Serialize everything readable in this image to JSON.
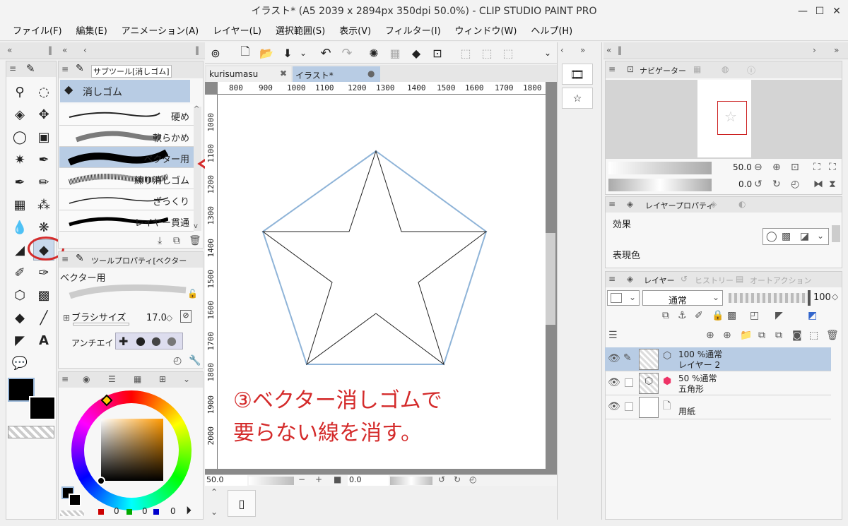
{
  "window": {
    "title": "イラスト* (A5 2039 x 2894px 350dpi 50.0%)  - CLIP STUDIO PAINT PRO",
    "controls": [
      "—",
      "☐",
      "✕"
    ]
  },
  "menu": [
    "ファイル(F)",
    "編集(E)",
    "アニメーション(A)",
    "レイヤー(L)",
    "選択範囲(S)",
    "表示(V)",
    "フィルター(I)",
    "ウィンドウ(W)",
    "ヘルプ(H)"
  ],
  "subtool": {
    "tab_label": "サブツール[消しゴム]",
    "group_name": "消しゴム",
    "brushes": [
      "硬め",
      "軟らかめ",
      "ベクター用",
      "練り消しゴム",
      "ざっくり",
      "レイヤー貫通"
    ],
    "selected": "ベクター用"
  },
  "tool_property": {
    "tab_label": "ツールプロパティ[ベクター",
    "preset_name": "ベクター用",
    "brush_size_label": "ブラシサイズ",
    "brush_size_value": "17.0",
    "antialias_label": "アンチエイリ"
  },
  "color": {
    "r": "0",
    "g": "0",
    "b": "0",
    "main": "#000000",
    "sub": "#000000"
  },
  "canvas": {
    "tabs": [
      {
        "label": "kurisumasu",
        "active": false,
        "close": "✖"
      },
      {
        "label": "イラスト*",
        "active": true,
        "close": "●"
      }
    ],
    "ruler_h": [
      "800",
      "900",
      "1000",
      "1100",
      "1200",
      "1300",
      "1400",
      "1500",
      "1600",
      "1700",
      "1800"
    ],
    "ruler_v": [
      "1000",
      "1100",
      "1200",
      "1300",
      "1400",
      "1500",
      "1600",
      "1700",
      "1800",
      "1900",
      "2000"
    ],
    "zoom_value": "50.0",
    "rotate_value": "0.0",
    "annotation_line1": "③ベクター消しゴムで",
    "annotation_line2": "要らない線を消す。"
  },
  "navigator": {
    "tab_label": "ナビゲーター",
    "zoom": "50.0",
    "rotate": "0.0"
  },
  "layer_property": {
    "tab_label": "レイヤープロパティ",
    "effect_label": "効果",
    "color_label": "表現色"
  },
  "layers_panel": {
    "tabs": [
      "レイヤー",
      "ヒストリー",
      "オートアクション"
    ],
    "blend_mode": "通常",
    "opacity": "100",
    "layers": [
      {
        "opacity_mode": "100 %通常",
        "name": "レイヤー 2",
        "selected": true
      },
      {
        "opacity_mode": "50 %通常",
        "name": "五角形",
        "selected": false
      },
      {
        "opacity_mode": "",
        "name": "用紙",
        "selected": false
      }
    ]
  },
  "colors": {
    "accent": "#b9cfe6",
    "selected_row": "#b8cce4",
    "annotation": "#d42b2b",
    "pentagon": "#8fb4d8"
  }
}
